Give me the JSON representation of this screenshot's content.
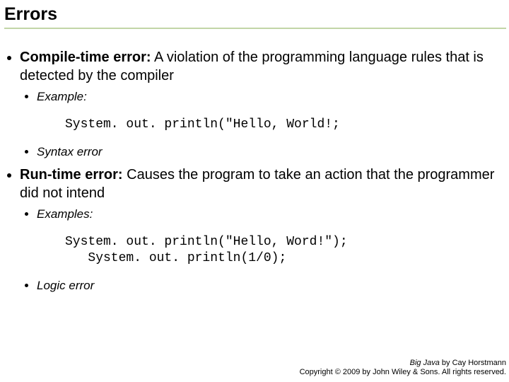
{
  "title": "Errors",
  "bullets": {
    "compile": {
      "term": "Compile-time error:",
      "desc": " A violation of the programming language rules that is detected by the compiler",
      "example_label": "Example:",
      "code": "System. out. println(\"Hello, World!;",
      "note": "Syntax error"
    },
    "runtime": {
      "term": "Run-time error:",
      "desc": " Causes the program to take an action that the programmer did not intend",
      "examples_label": "Examples:",
      "code": "System. out. println(\"Hello, Word!\");\n   System. out. println(1/0);",
      "note": "Logic error"
    }
  },
  "footer": {
    "book": "Big Java",
    "author": " by Cay Horstmann",
    "copyright": "Copyright © 2009 by John Wiley & Sons. All rights reserved."
  }
}
